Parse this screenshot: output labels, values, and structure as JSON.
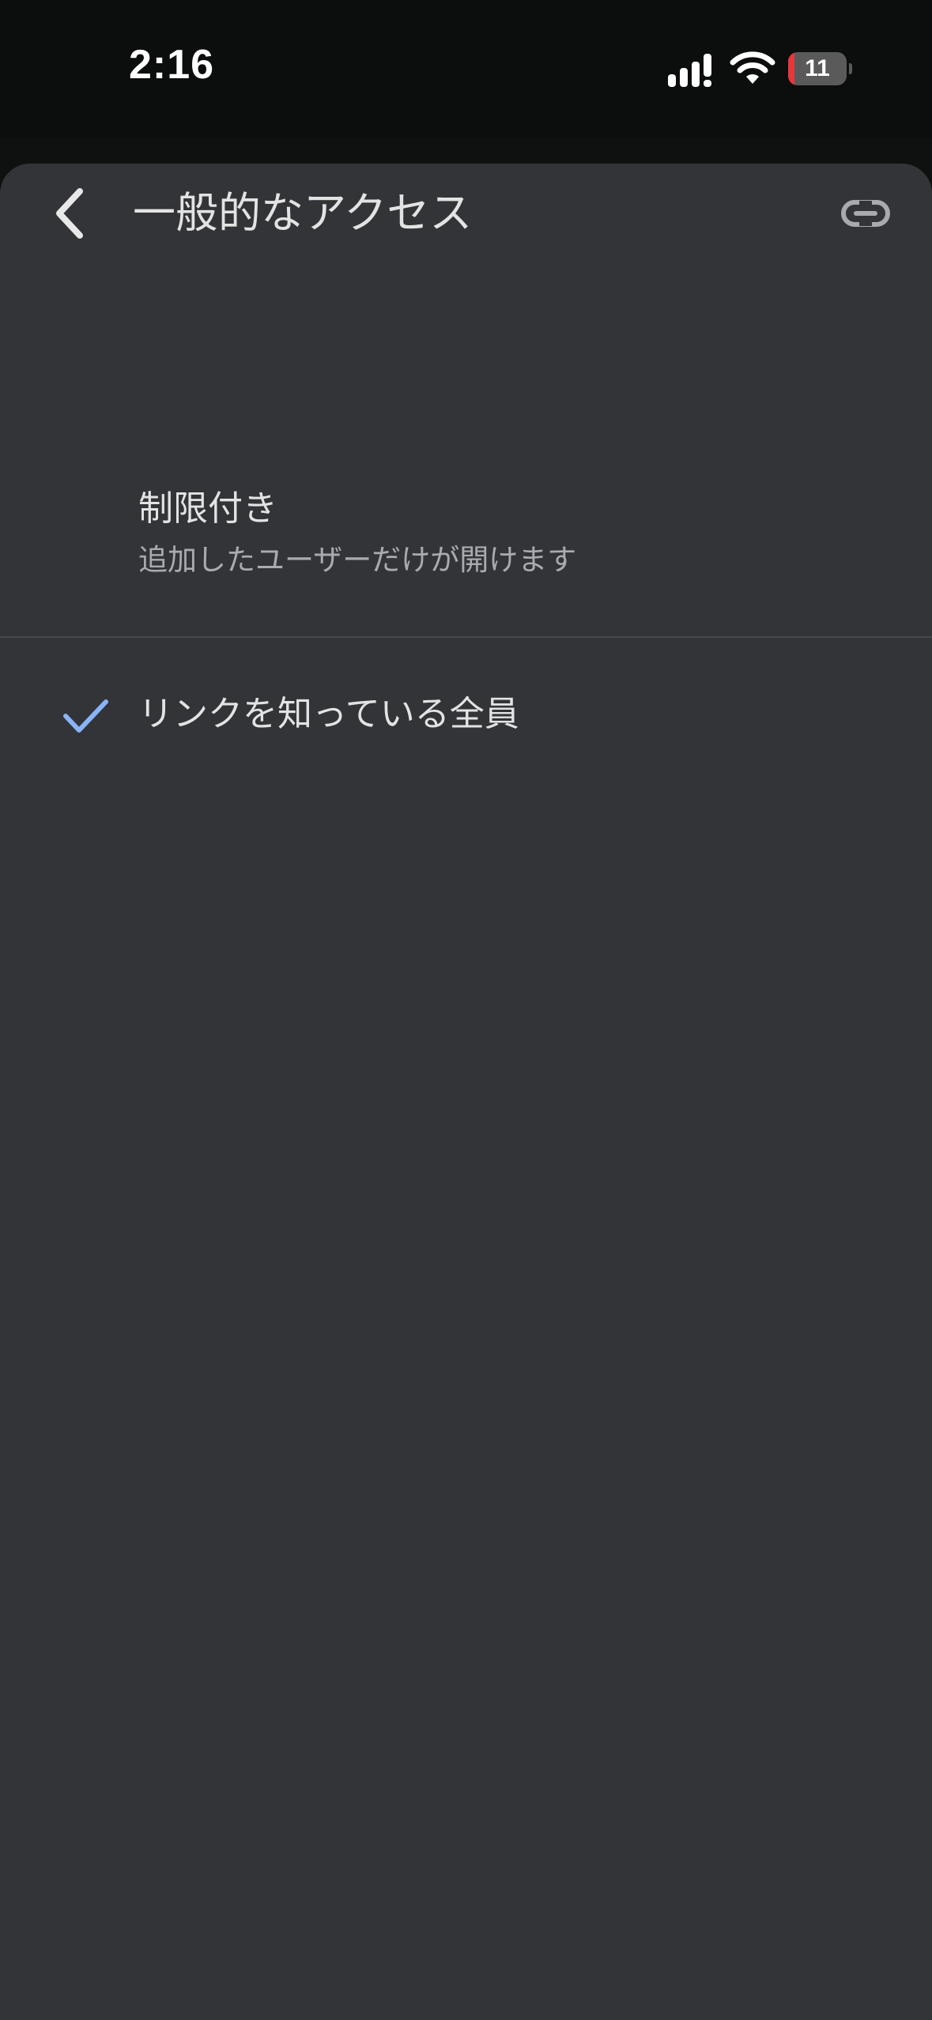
{
  "status_bar": {
    "time": "2:16",
    "battery_level": "11",
    "battery_fraction": 0.11,
    "icons": [
      "signal-icon",
      "wifi-icon",
      "battery-icon"
    ]
  },
  "sheet": {
    "title": "一般的なアクセス",
    "back_icon": "chevron-left-icon",
    "link_icon": "link-icon"
  },
  "options": [
    {
      "title": "制限付き",
      "description": "追加したユーザーだけが開けます",
      "selected": false
    },
    {
      "title": "リンクを知っている全員",
      "selected": true
    }
  ],
  "colors": {
    "sheet_background": "#333438",
    "check_accent": "#8ab4f8",
    "primary_text": "#e3e3e3",
    "secondary_text": "#a9abaf"
  }
}
